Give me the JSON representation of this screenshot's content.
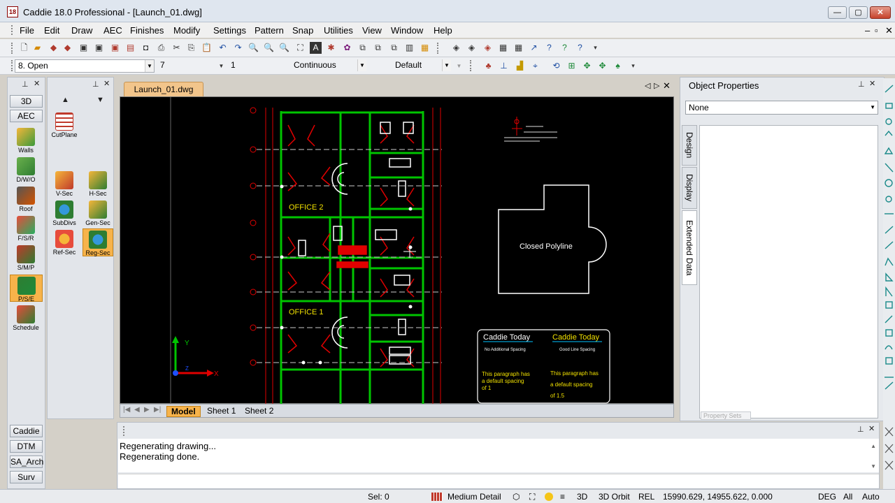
{
  "window": {
    "title": "Caddie 18.0 Professional - [Launch_01.dwg]",
    "app_icon_text": "18",
    "minimize": "—",
    "maximize": "▢",
    "close": "✕"
  },
  "menu": {
    "items": [
      "File",
      "Edit",
      "Draw",
      "AEC",
      "Finishes",
      "Modify",
      "Settings",
      "Pattern",
      "Snap",
      "Utilities",
      "View",
      "Window",
      "Help"
    ],
    "mdi_controls": [
      "–",
      "▫",
      "✕"
    ]
  },
  "toolbar2": {
    "layer": "8. Open",
    "color": "7",
    "lineweight": "1",
    "linetype": "Continuous",
    "style": "Default"
  },
  "left_panel": {
    "tabs_top": [
      "3D",
      "AEC"
    ],
    "tools": [
      "Walls",
      "D/W/O",
      "Roof",
      "F/S/R",
      "S/M/P",
      "P/S/E",
      "Schedule"
    ],
    "tabs_bottom": [
      "Caddie",
      "DTM",
      "SA_Arch",
      "Surv"
    ]
  },
  "left_panel2": {
    "tools": [
      "CutPlane",
      "V-Sec",
      "H-Sec",
      "SubDivs",
      "Gen-Sec",
      "Ref-Sec",
      "Reg-Sec"
    ]
  },
  "document": {
    "tab": "Launch_01.dwg",
    "sheet_tabs": [
      "Model",
      "Sheet 1",
      "Sheet 2"
    ]
  },
  "drawing": {
    "office2": "OFFICE 2",
    "office1": "OFFICE 1",
    "polyline_label": "Closed Polyline",
    "note_left_title": "Caddie Today",
    "note_left_sub": "No Additional Spacing",
    "note_left_body": [
      "This paragraph has",
      "a default spacing",
      "of 1"
    ],
    "note_right_title": "Caddie Today",
    "note_right_sub": "Good Line Spacing",
    "note_right_body": [
      "This paragraph has",
      "a default spacing",
      "of 1.5"
    ],
    "axis_y": "Y",
    "axis_x": "X",
    "axis_z": "Z"
  },
  "properties": {
    "title": "Object Properties",
    "selection": "None",
    "tabs": [
      "Design",
      "Display",
      "Extended Data"
    ],
    "footer_hint": "Property Sets"
  },
  "command": {
    "history": [
      "Regenerating drawing...",
      "Regenerating done."
    ]
  },
  "status": {
    "sel": "Sel: 0",
    "detail": "Medium Detail",
    "mode_3d": "3D",
    "orbit": "3D Orbit",
    "rel": "REL",
    "coords": "15990.629, 14955.622, 0.000",
    "deg": "DEG",
    "all": "All",
    "auto": "Auto"
  },
  "colors": {
    "canvas": "#000000",
    "wall": "#00c400",
    "red": "#e00000",
    "white": "#ffffff",
    "yellow": "#f0e000",
    "accent_tab": "#f7b34a"
  }
}
